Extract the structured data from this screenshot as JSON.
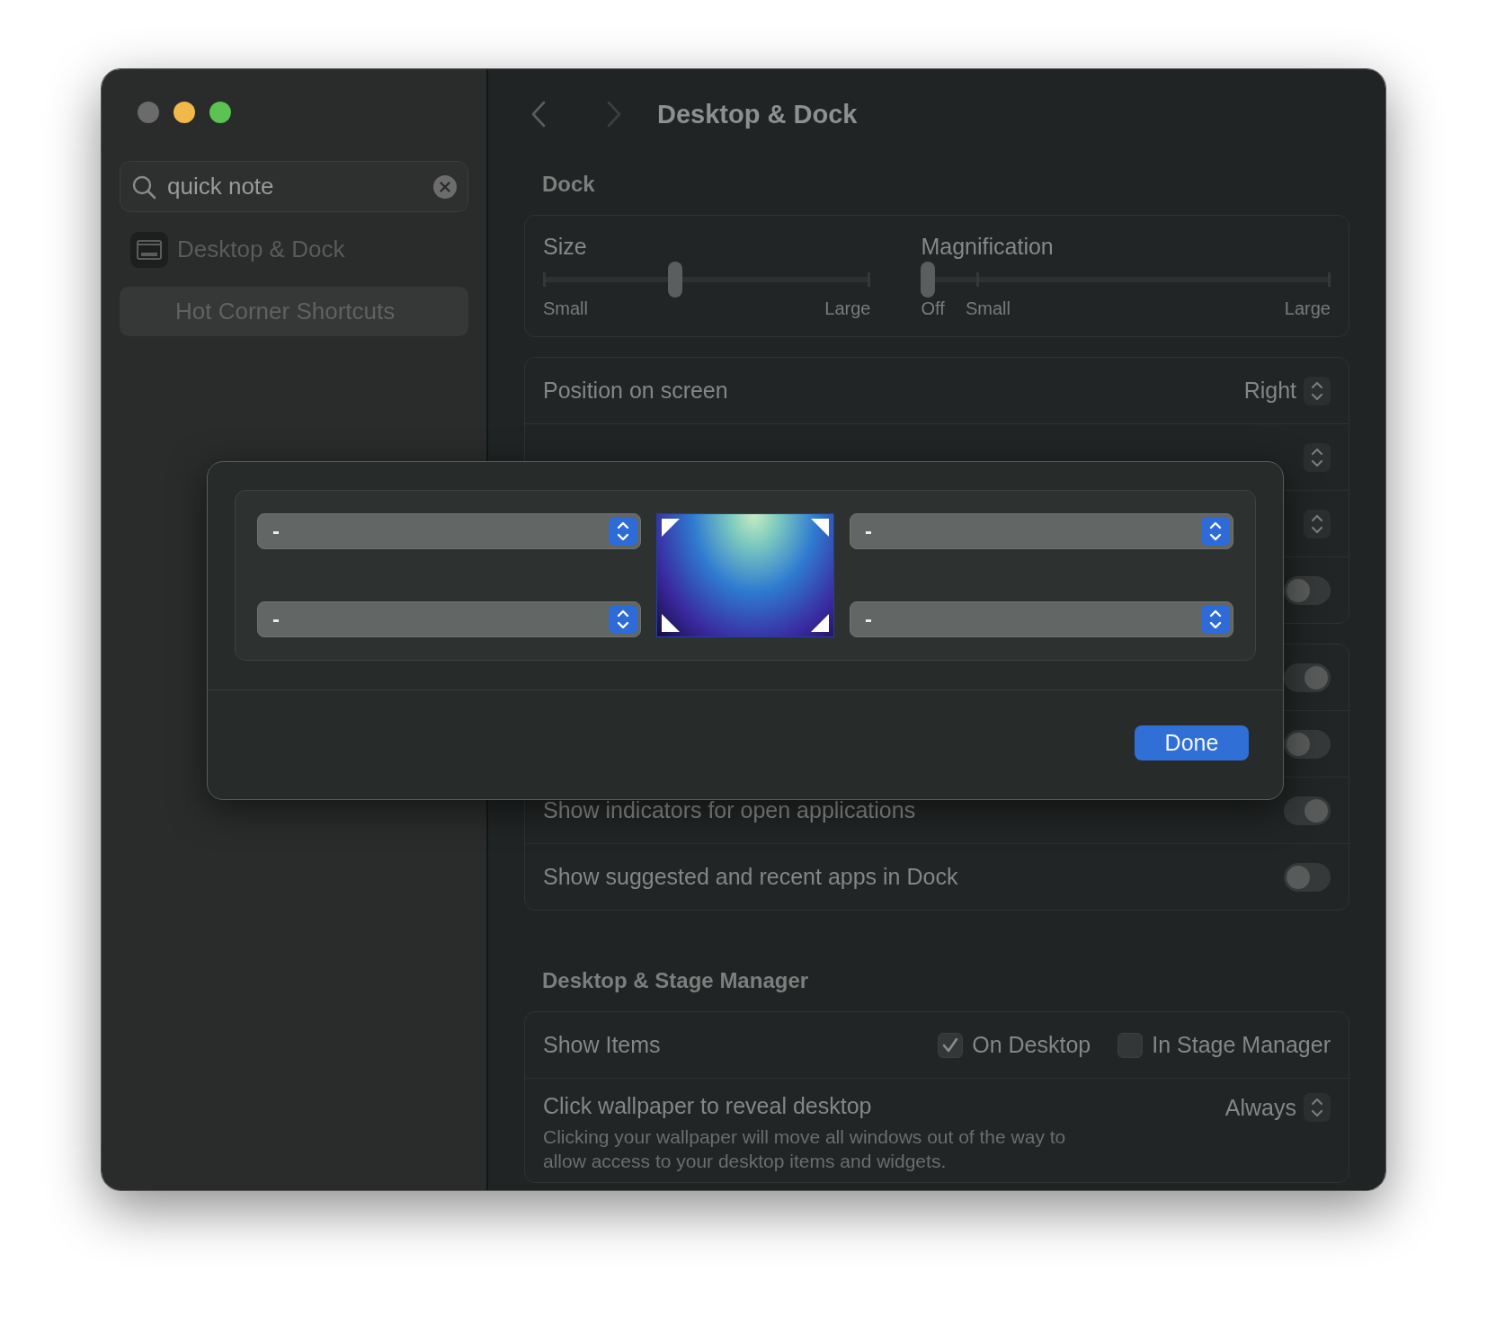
{
  "window": {
    "title": "Desktop & Dock"
  },
  "sidebar": {
    "search": {
      "value": "quick note"
    },
    "items": [
      {
        "label": "Desktop & Dock",
        "selected": false
      },
      {
        "label": "Hot Corner Shortcuts",
        "selected": true
      }
    ]
  },
  "sections": [
    {
      "heading": "Dock",
      "groups": [
        {
          "kind": "sliders",
          "sliders": [
            {
              "label": "Size",
              "level": 0.4,
              "marks": [
                "Small",
                "Large"
              ]
            },
            {
              "label": "Magnification",
              "level": 0,
              "marks": [
                "Off",
                "Small",
                "Large"
              ]
            }
          ]
        },
        {
          "kind": "rows",
          "rows": [
            {
              "kind": "popup",
              "label": "Position on screen",
              "value": "Right"
            },
            {
              "kind": "popup"
            },
            {
              "kind": "popup"
            },
            {
              "kind": "toggle",
              "on": false
            }
          ]
        },
        {
          "kind": "rows",
          "rows": [
            {
              "kind": "toggle",
              "on": true
            },
            {
              "kind": "toggle",
              "on": false
            },
            {
              "kind": "toggle",
              "label": "Show indicators for open applications",
              "on": true
            },
            {
              "kind": "toggle",
              "label": "Show suggested and recent apps in Dock",
              "on": false
            }
          ]
        }
      ]
    },
    {
      "heading": "Desktop & Stage Manager",
      "groups": [
        {
          "kind": "rows",
          "rows": [
            {
              "kind": "checks",
              "label": "Show Items",
              "options": [
                {
                  "label": "On Desktop",
                  "checked": true
                },
                {
                  "label": "In Stage Manager",
                  "checked": false
                }
              ]
            },
            {
              "kind": "popup",
              "label": "Click wallpaper to reveal desktop",
              "value": "Always",
              "description": "Clicking your wallpaper will move all windows out of the way to allow access to your desktop items and widgets."
            }
          ]
        }
      ]
    }
  ],
  "hot_corners": {
    "corners": [
      {
        "value": "-"
      },
      {
        "value": "-"
      },
      {
        "value": "-"
      },
      {
        "value": "-"
      }
    ],
    "button": "Done"
  }
}
